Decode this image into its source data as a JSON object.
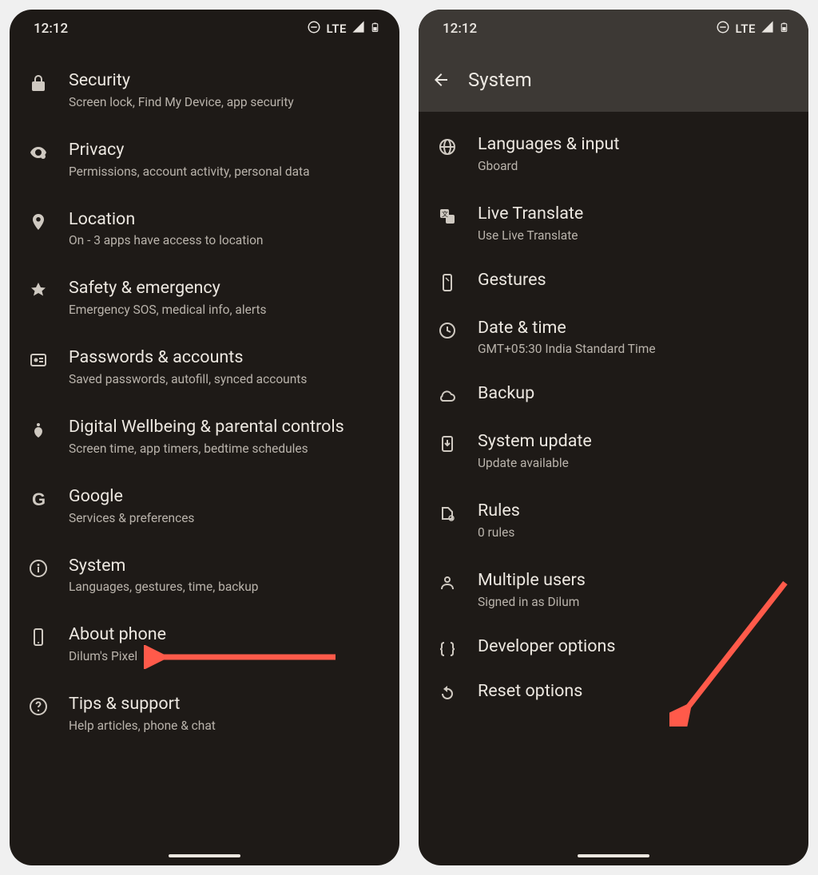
{
  "status": {
    "time": "12:12",
    "network_label": "LTE"
  },
  "left_screen": {
    "items": [
      {
        "icon": "lock",
        "title": "Security",
        "sub": "Screen lock, Find My Device, app security"
      },
      {
        "icon": "privacy",
        "title": "Privacy",
        "sub": "Permissions, account activity, personal data"
      },
      {
        "icon": "location",
        "title": "Location",
        "sub": "On - 3 apps have access to location"
      },
      {
        "icon": "medical",
        "title": "Safety & emergency",
        "sub": "Emergency SOS, medical info, alerts"
      },
      {
        "icon": "account",
        "title": "Passwords & accounts",
        "sub": "Saved passwords, autofill, synced accounts"
      },
      {
        "icon": "wellbeing",
        "title": "Digital Wellbeing & parental controls",
        "sub": "Screen time, app timers, bedtime schedules"
      },
      {
        "icon": "google",
        "title": "Google",
        "sub": "Services & preferences"
      },
      {
        "icon": "info",
        "title": "System",
        "sub": "Languages, gestures, time, backup"
      },
      {
        "icon": "phone",
        "title": "About phone",
        "sub": "Dilum's Pixel"
      },
      {
        "icon": "help",
        "title": "Tips & support",
        "sub": "Help articles, phone & chat"
      }
    ]
  },
  "right_screen": {
    "appbar_title": "System",
    "items": [
      {
        "icon": "globe",
        "title": "Languages & input",
        "sub": "Gboard"
      },
      {
        "icon": "translate",
        "title": "Live Translate",
        "sub": "Use Live Translate"
      },
      {
        "icon": "gesture",
        "title": "Gestures",
        "sub": ""
      },
      {
        "icon": "clock",
        "title": "Date & time",
        "sub": "GMT+05:30 India Standard Time"
      },
      {
        "icon": "cloud",
        "title": "Backup",
        "sub": ""
      },
      {
        "icon": "download",
        "title": "System update",
        "sub": "Update available"
      },
      {
        "icon": "rules",
        "title": "Rules",
        "sub": "0 rules"
      },
      {
        "icon": "users",
        "title": "Multiple users",
        "sub": "Signed in as Dilum"
      },
      {
        "icon": "braces",
        "title": "Developer options",
        "sub": ""
      },
      {
        "icon": "reset",
        "title": "Reset options",
        "sub": ""
      }
    ]
  },
  "annotations": {
    "arrow1_target": "System",
    "arrow2_target": "Developer options"
  }
}
